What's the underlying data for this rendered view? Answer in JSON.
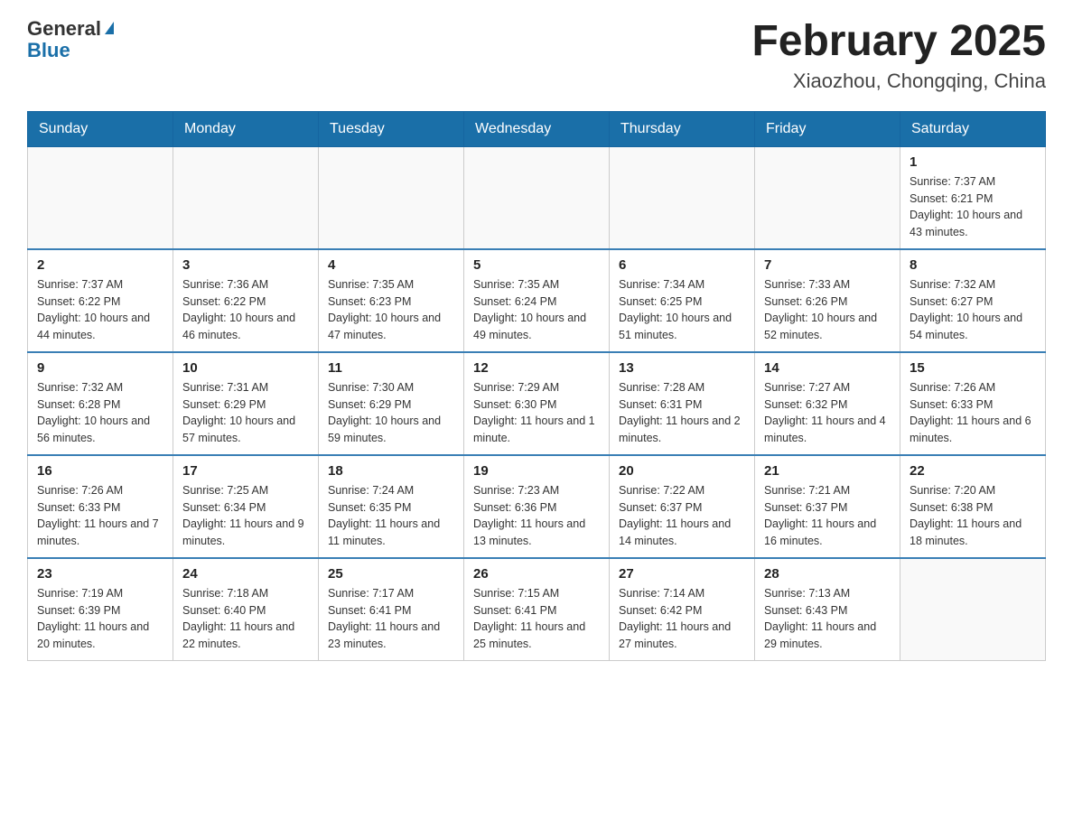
{
  "header": {
    "logo_general": "General",
    "logo_blue": "Blue",
    "title": "February 2025",
    "subtitle": "Xiaozhou, Chongqing, China"
  },
  "weekdays": [
    "Sunday",
    "Monday",
    "Tuesday",
    "Wednesday",
    "Thursday",
    "Friday",
    "Saturday"
  ],
  "weeks": [
    [
      {
        "day": "",
        "sunrise": "",
        "sunset": "",
        "daylight": "",
        "empty": true
      },
      {
        "day": "",
        "sunrise": "",
        "sunset": "",
        "daylight": "",
        "empty": true
      },
      {
        "day": "",
        "sunrise": "",
        "sunset": "",
        "daylight": "",
        "empty": true
      },
      {
        "day": "",
        "sunrise": "",
        "sunset": "",
        "daylight": "",
        "empty": true
      },
      {
        "day": "",
        "sunrise": "",
        "sunset": "",
        "daylight": "",
        "empty": true
      },
      {
        "day": "",
        "sunrise": "",
        "sunset": "",
        "daylight": "",
        "empty": true
      },
      {
        "day": "1",
        "sunrise": "Sunrise: 7:37 AM",
        "sunset": "Sunset: 6:21 PM",
        "daylight": "Daylight: 10 hours and 43 minutes.",
        "empty": false
      }
    ],
    [
      {
        "day": "2",
        "sunrise": "Sunrise: 7:37 AM",
        "sunset": "Sunset: 6:22 PM",
        "daylight": "Daylight: 10 hours and 44 minutes.",
        "empty": false
      },
      {
        "day": "3",
        "sunrise": "Sunrise: 7:36 AM",
        "sunset": "Sunset: 6:22 PM",
        "daylight": "Daylight: 10 hours and 46 minutes.",
        "empty": false
      },
      {
        "day": "4",
        "sunrise": "Sunrise: 7:35 AM",
        "sunset": "Sunset: 6:23 PM",
        "daylight": "Daylight: 10 hours and 47 minutes.",
        "empty": false
      },
      {
        "day": "5",
        "sunrise": "Sunrise: 7:35 AM",
        "sunset": "Sunset: 6:24 PM",
        "daylight": "Daylight: 10 hours and 49 minutes.",
        "empty": false
      },
      {
        "day": "6",
        "sunrise": "Sunrise: 7:34 AM",
        "sunset": "Sunset: 6:25 PM",
        "daylight": "Daylight: 10 hours and 51 minutes.",
        "empty": false
      },
      {
        "day": "7",
        "sunrise": "Sunrise: 7:33 AM",
        "sunset": "Sunset: 6:26 PM",
        "daylight": "Daylight: 10 hours and 52 minutes.",
        "empty": false
      },
      {
        "day": "8",
        "sunrise": "Sunrise: 7:32 AM",
        "sunset": "Sunset: 6:27 PM",
        "daylight": "Daylight: 10 hours and 54 minutes.",
        "empty": false
      }
    ],
    [
      {
        "day": "9",
        "sunrise": "Sunrise: 7:32 AM",
        "sunset": "Sunset: 6:28 PM",
        "daylight": "Daylight: 10 hours and 56 minutes.",
        "empty": false
      },
      {
        "day": "10",
        "sunrise": "Sunrise: 7:31 AM",
        "sunset": "Sunset: 6:29 PM",
        "daylight": "Daylight: 10 hours and 57 minutes.",
        "empty": false
      },
      {
        "day": "11",
        "sunrise": "Sunrise: 7:30 AM",
        "sunset": "Sunset: 6:29 PM",
        "daylight": "Daylight: 10 hours and 59 minutes.",
        "empty": false
      },
      {
        "day": "12",
        "sunrise": "Sunrise: 7:29 AM",
        "sunset": "Sunset: 6:30 PM",
        "daylight": "Daylight: 11 hours and 1 minute.",
        "empty": false
      },
      {
        "day": "13",
        "sunrise": "Sunrise: 7:28 AM",
        "sunset": "Sunset: 6:31 PM",
        "daylight": "Daylight: 11 hours and 2 minutes.",
        "empty": false
      },
      {
        "day": "14",
        "sunrise": "Sunrise: 7:27 AM",
        "sunset": "Sunset: 6:32 PM",
        "daylight": "Daylight: 11 hours and 4 minutes.",
        "empty": false
      },
      {
        "day": "15",
        "sunrise": "Sunrise: 7:26 AM",
        "sunset": "Sunset: 6:33 PM",
        "daylight": "Daylight: 11 hours and 6 minutes.",
        "empty": false
      }
    ],
    [
      {
        "day": "16",
        "sunrise": "Sunrise: 7:26 AM",
        "sunset": "Sunset: 6:33 PM",
        "daylight": "Daylight: 11 hours and 7 minutes.",
        "empty": false
      },
      {
        "day": "17",
        "sunrise": "Sunrise: 7:25 AM",
        "sunset": "Sunset: 6:34 PM",
        "daylight": "Daylight: 11 hours and 9 minutes.",
        "empty": false
      },
      {
        "day": "18",
        "sunrise": "Sunrise: 7:24 AM",
        "sunset": "Sunset: 6:35 PM",
        "daylight": "Daylight: 11 hours and 11 minutes.",
        "empty": false
      },
      {
        "day": "19",
        "sunrise": "Sunrise: 7:23 AM",
        "sunset": "Sunset: 6:36 PM",
        "daylight": "Daylight: 11 hours and 13 minutes.",
        "empty": false
      },
      {
        "day": "20",
        "sunrise": "Sunrise: 7:22 AM",
        "sunset": "Sunset: 6:37 PM",
        "daylight": "Daylight: 11 hours and 14 minutes.",
        "empty": false
      },
      {
        "day": "21",
        "sunrise": "Sunrise: 7:21 AM",
        "sunset": "Sunset: 6:37 PM",
        "daylight": "Daylight: 11 hours and 16 minutes.",
        "empty": false
      },
      {
        "day": "22",
        "sunrise": "Sunrise: 7:20 AM",
        "sunset": "Sunset: 6:38 PM",
        "daylight": "Daylight: 11 hours and 18 minutes.",
        "empty": false
      }
    ],
    [
      {
        "day": "23",
        "sunrise": "Sunrise: 7:19 AM",
        "sunset": "Sunset: 6:39 PM",
        "daylight": "Daylight: 11 hours and 20 minutes.",
        "empty": false
      },
      {
        "day": "24",
        "sunrise": "Sunrise: 7:18 AM",
        "sunset": "Sunset: 6:40 PM",
        "daylight": "Daylight: 11 hours and 22 minutes.",
        "empty": false
      },
      {
        "day": "25",
        "sunrise": "Sunrise: 7:17 AM",
        "sunset": "Sunset: 6:41 PM",
        "daylight": "Daylight: 11 hours and 23 minutes.",
        "empty": false
      },
      {
        "day": "26",
        "sunrise": "Sunrise: 7:15 AM",
        "sunset": "Sunset: 6:41 PM",
        "daylight": "Daylight: 11 hours and 25 minutes.",
        "empty": false
      },
      {
        "day": "27",
        "sunrise": "Sunrise: 7:14 AM",
        "sunset": "Sunset: 6:42 PM",
        "daylight": "Daylight: 11 hours and 27 minutes.",
        "empty": false
      },
      {
        "day": "28",
        "sunrise": "Sunrise: 7:13 AM",
        "sunset": "Sunset: 6:43 PM",
        "daylight": "Daylight: 11 hours and 29 minutes.",
        "empty": false
      },
      {
        "day": "",
        "sunrise": "",
        "sunset": "",
        "daylight": "",
        "empty": true
      }
    ]
  ]
}
